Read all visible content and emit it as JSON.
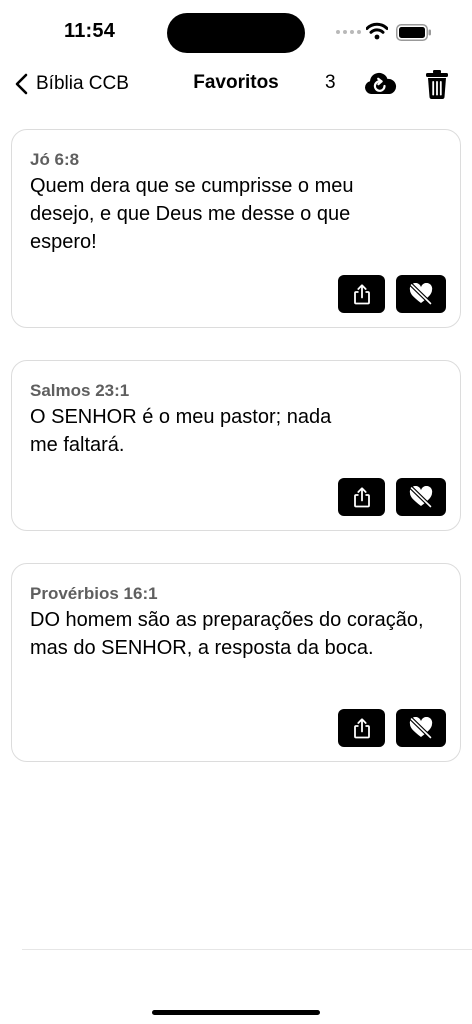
{
  "status_bar": {
    "time": "11:54"
  },
  "nav": {
    "back_label": "Bíblia CCB",
    "title": "Favoritos",
    "count": "3"
  },
  "favorites": [
    {
      "reference": "Jó 6:8",
      "text": "Quem dera que se cumprisse o meu desejo, e que Deus me desse o que espero!"
    },
    {
      "reference": "Salmos 23:1",
      "text": "O SENHOR é o meu pastor; nada me faltará."
    },
    {
      "reference": "Provérbios 16:1",
      "text": "DO homem são as preparações do coração, mas do SENHOR, a resposta da boca."
    }
  ]
}
